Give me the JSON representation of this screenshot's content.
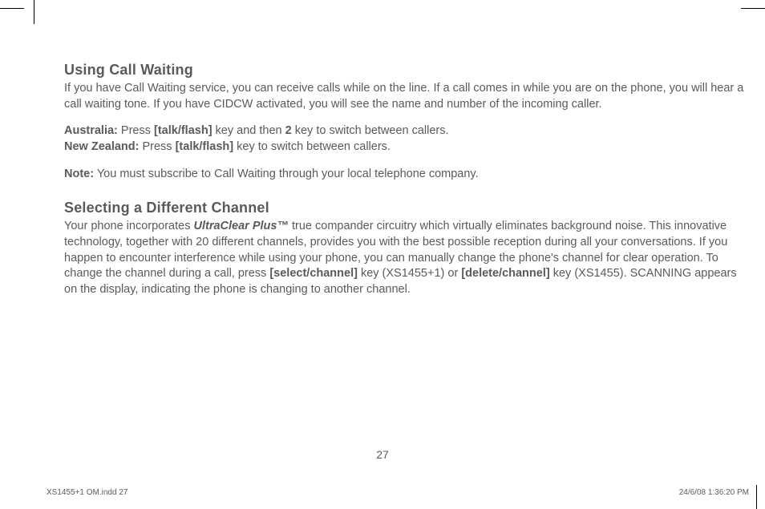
{
  "section1": {
    "heading": "Using Call Waiting",
    "intro": "If you have Call Waiting service, you can receive calls while on the line. If a call comes in while you are on the phone, you will hear a call waiting tone. If you have CIDCW activated, you will see the name and number of the incoming caller.",
    "australia": {
      "label": "Australia:",
      "t1": " Press ",
      "key": "[talk/flash]",
      "t2": " key and then ",
      "num": "2",
      "t3": " key to switch between callers."
    },
    "nz": {
      "label": "New Zealand:",
      "t1": " Press ",
      "key": "[talk/flash]",
      "t2": " key to switch between callers."
    },
    "note": {
      "label": "Note:",
      "text": " You must subscribe to Call Waiting through your local telephone company."
    }
  },
  "section2": {
    "heading": "Selecting a Different Channel",
    "t1": "Your phone incorporates ",
    "product": "UltraClear Plus™",
    "t2": " true compander circuitry which virtually eliminates background noise. This innovative technology, together with 20 different channels, provides you with the best possible reception during all your conversations. If you happen to encounter interference while using your phone, you can manually change the phone's channel for clear operation. To change the channel during a call, press ",
    "key1": "[select/channel]",
    "t3": " key (XS1455+1) or ",
    "key2": "[delete/channel]",
    "t4": " key (XS1455). SCANNING appears on the display, indicating the phone is changing to another channel."
  },
  "page_number": "27",
  "footer": {
    "left": "XS1455+1 OM.indd   27",
    "right": "24/6/08   1:36:20 PM"
  }
}
